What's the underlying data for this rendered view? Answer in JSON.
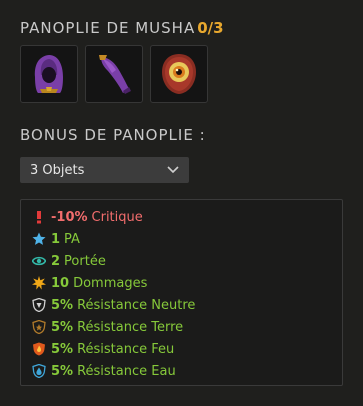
{
  "panoplie": {
    "title": "PANOPLIE DE MUSHA",
    "count": "0/3",
    "items": [
      {
        "icon": "purple-hood-icon"
      },
      {
        "icon": "purple-cape-icon"
      },
      {
        "icon": "eye-shield-icon"
      }
    ]
  },
  "bonus": {
    "title": "BONUS DE PANOPLIE :",
    "selector": {
      "value": "3 Objets"
    },
    "lines": [
      {
        "icon": "critical-icon",
        "value": "-10%",
        "label": "Critique",
        "color": "#f26d6d"
      },
      {
        "icon": "star-icon",
        "value": "1",
        "label": "PA",
        "color": "#86c93a"
      },
      {
        "icon": "eye-icon",
        "value": "2",
        "label": "Portée",
        "color": "#86c93a"
      },
      {
        "icon": "damage-burst-icon",
        "value": "10",
        "label": "Dommages",
        "color": "#86c93a"
      },
      {
        "icon": "neutral-shield-icon",
        "value": "5%",
        "label": "Résistance Neutre",
        "color": "#86c93a"
      },
      {
        "icon": "earth-shield-icon",
        "value": "5%",
        "label": "Résistance Terre",
        "color": "#86c93a"
      },
      {
        "icon": "fire-shield-icon",
        "value": "5%",
        "label": "Résistance Feu",
        "color": "#86c93a"
      },
      {
        "icon": "water-shield-icon",
        "value": "5%",
        "label": "Résistance Eau",
        "color": "#86c93a"
      }
    ]
  }
}
